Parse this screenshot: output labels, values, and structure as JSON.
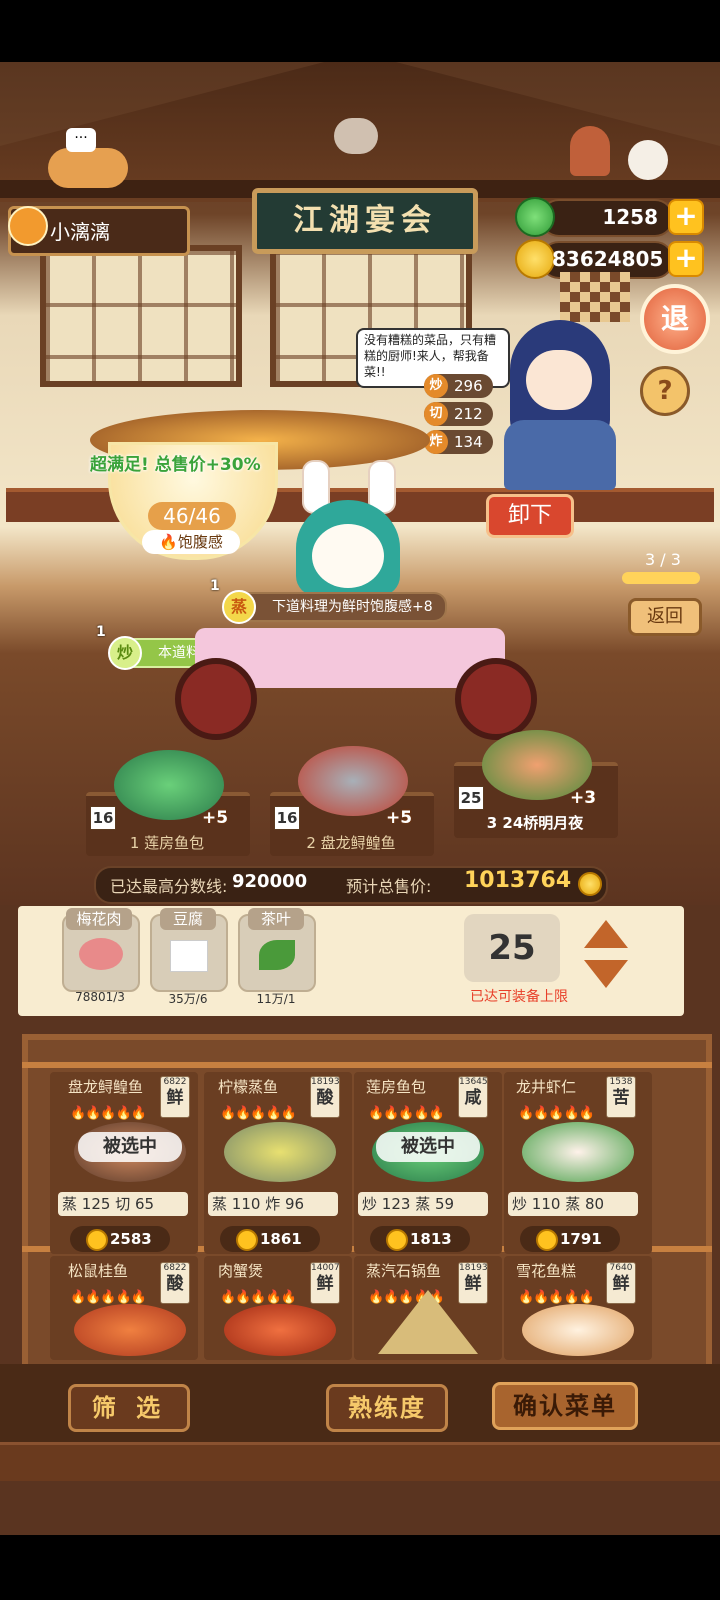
{
  "player": {
    "name": "小漓漓"
  },
  "resources": {
    "gems": "1258",
    "coins": "83624805"
  },
  "sign": "江湖宴会",
  "exit_label": "退",
  "help_label": "?",
  "chef": {
    "speech": "没有糟糕的菜品，只有糟糕的厨师!来人，帮我备菜!!",
    "skills": [
      {
        "icon": "炒",
        "value": "296"
      },
      {
        "icon": "切",
        "value": "212"
      },
      {
        "icon": "炸",
        "value": "134"
      }
    ]
  },
  "unload_label": "卸下",
  "pager": "3 / 3",
  "back_label": "返回",
  "satisfaction": {
    "bonus": "超满足!  总售价+30%",
    "value": "46/46",
    "label": "饱腹感"
  },
  "tips": [
    {
      "count": "1",
      "icon": "蒸",
      "text": "下道料理为鲜时饱腹感+8"
    },
    {
      "count": "1",
      "icon": "炒",
      "text": "本道料理售价+150%"
    }
  ],
  "slots": [
    {
      "level": "16",
      "index": "1",
      "name": "莲房鱼包",
      "fire": "+5"
    },
    {
      "level": "16",
      "index": "2",
      "name": "盘龙鲟鳇鱼",
      "fire": "+5"
    },
    {
      "level": "25",
      "index": "3",
      "name": "24桥明月夜",
      "fire": "+3"
    }
  ],
  "score": {
    "max_label": "已达最高分数线:",
    "max_value": "920000",
    "total_label": "预计总售价:",
    "total_value": "1013764"
  },
  "ingredients": [
    {
      "name": "梅花肉",
      "count": "78801/3"
    },
    {
      "name": "豆腐",
      "count": "35万/6"
    },
    {
      "name": "茶叶",
      "count": "11万/1"
    }
  ],
  "equip": {
    "value": "25",
    "limit": "已达可装备上限"
  },
  "dishes": [
    {
      "name": "盘龙鲟鳇鱼",
      "badge_num": "6822",
      "taste": "鲜",
      "flames": "🔥🔥🔥🔥🔥",
      "selected": "被选中",
      "s1": "蒸",
      "v1": "125",
      "s2": "切",
      "v2": "65",
      "price": "2583"
    },
    {
      "name": "柠檬蒸鱼",
      "badge_num": "18193",
      "taste": "酸",
      "flames": "🔥🔥🔥🔥🔥",
      "selected": "",
      "s1": "蒸",
      "v1": "110",
      "s2": "炸",
      "v2": "96",
      "price": "1861"
    },
    {
      "name": "莲房鱼包",
      "badge_num": "13645",
      "taste": "咸",
      "flames": "🔥🔥🔥🔥🔥",
      "selected": "被选中",
      "s1": "炒",
      "v1": "123",
      "s2": "蒸",
      "v2": "59",
      "price": "1813"
    },
    {
      "name": "龙井虾仁",
      "badge_num": "1538",
      "taste": "苦",
      "flames": "🔥🔥🔥🔥🔥",
      "selected": "",
      "s1": "炒",
      "v1": "110",
      "s2": "蒸",
      "v2": "80",
      "price": "1791"
    },
    {
      "name": "松鼠桂鱼",
      "badge_num": "6822",
      "taste": "酸",
      "flames": "🔥🔥🔥🔥🔥"
    },
    {
      "name": "肉蟹煲",
      "badge_num": "14007",
      "taste": "鲜",
      "flames": "🔥🔥🔥🔥🔥"
    },
    {
      "name": "蒸汽石锅鱼",
      "badge_num": "18193",
      "taste": "鲜",
      "flames": "🔥🔥🔥🔥🔥"
    },
    {
      "name": "雪花鱼糕",
      "badge_num": "7640",
      "taste": "鲜",
      "flames": "🔥🔥🔥🔥🔥"
    }
  ],
  "buttons": {
    "filter": "筛 选",
    "proficiency": "熟练度",
    "confirm": "确认菜单"
  },
  "colors": {
    "accent": "#ffc21f",
    "gem": "#2f9a36",
    "warning": "#e8402a"
  }
}
